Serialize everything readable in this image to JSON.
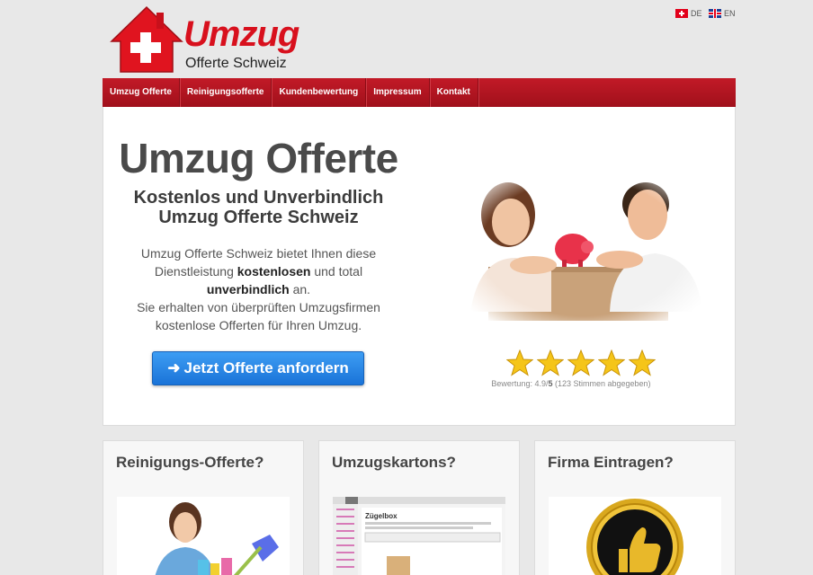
{
  "brand": {
    "name": "Umzug",
    "tagline": "Offerte Schweiz"
  },
  "languages": [
    {
      "code": "DE",
      "flag": "swiss-flag-icon"
    },
    {
      "code": "EN",
      "flag": "uk-flag-icon"
    }
  ],
  "nav": {
    "items": [
      "Umzug Offerte",
      "Reinigungsofferte",
      "Kundenbewertung",
      "Impressum",
      "Kontakt"
    ]
  },
  "hero": {
    "title": "Umzug Offerte",
    "subtitle_line1": "Kostenlos und Unverbindlich",
    "subtitle_line2": "Umzug Offerte Schweiz",
    "text_part1": "Umzug Offerte Schweiz bietet Ihnen diese Dienstleistung ",
    "text_bold1": "kostenlosen",
    "text_part2": " und total ",
    "text_bold2": "unverbindlich",
    "text_part3": " an.",
    "text_line2": "Sie erhalten von überprüften Umzugsfirmen kostenlose Offerten für Ihren Umzug.",
    "cta_arrow": "➜",
    "cta_label": "Jetzt Offerte anfordern"
  },
  "rating": {
    "stars": 5,
    "label_prefix": "Bewertung: 4.9/",
    "label_max": "5",
    "label_suffix": " (123 Stimmen abgegeben)"
  },
  "cards": [
    {
      "title": "Reinigungs-Offerte?",
      "image": "cleaning-woman-image"
    },
    {
      "title": "Umzugskartons?",
      "image": "zuegelbox-screenshot-image",
      "image_caption": "Zügelbox"
    },
    {
      "title": "Firma Eintragen?",
      "image": "thumbs-up-medal-image"
    }
  ],
  "colors": {
    "brand_red": "#d8101d",
    "nav_red": "#b01420",
    "cta_blue": "#2a86e6",
    "star_gold": "#f5c518"
  }
}
